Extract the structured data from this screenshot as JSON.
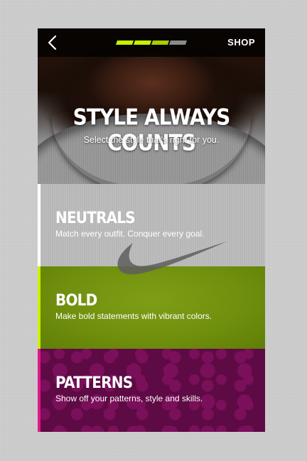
{
  "topbar": {
    "back_icon": "chevron-left-icon",
    "progress_segments": 4,
    "progress_active": 3,
    "shop_label": "SHOP"
  },
  "hero": {
    "title": "STYLE ALWAYS COUNTS",
    "subtitle": "Select the style that's right for you."
  },
  "options": [
    {
      "title": "NEUTRALS",
      "description": "Match every outfit. Conquer every goal.",
      "accent": "#ffffff"
    },
    {
      "title": "BOLD",
      "description": "Make bold statements with vibrant colors.",
      "accent": "#c8f000"
    },
    {
      "title": "PATTERNS",
      "description": "Show off your patterns, style and skills.",
      "accent": "#e0168c"
    }
  ],
  "colors": {
    "progress_active": "#c8f000",
    "progress_inactive": "#8a8a8a",
    "swoosh": "#5e5e5e"
  }
}
